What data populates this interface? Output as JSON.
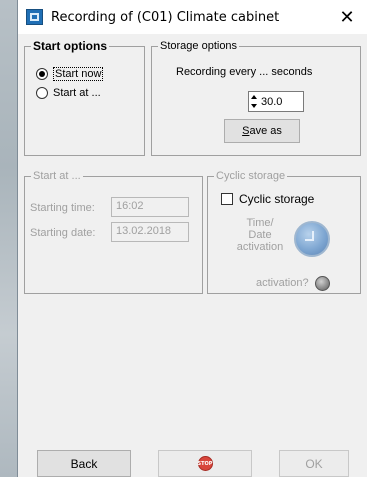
{
  "window": {
    "title": "Recording of (C01) Climate cabinet",
    "close_glyph": "✕"
  },
  "start_options": {
    "legend": "Start options",
    "start_now_label": "Start now",
    "start_at_label": "Start at ...",
    "selected": "start_now"
  },
  "storage_options": {
    "legend": "Storage options",
    "recording_label": "Recording every ... seconds",
    "interval_value": "30.0",
    "save_as_label": "Save as"
  },
  "start_at": {
    "legend": "Start at ...",
    "starting_time_label": "Starting time:",
    "starting_time_value": "16:02",
    "starting_date_label": "Starting date:",
    "starting_date_value": "13.02.2018"
  },
  "cyclic_storage": {
    "legend": "Cyclic storage",
    "checkbox_label": "Cyclic storage",
    "checked": false,
    "time_label_line1": "Time/",
    "time_label_line2": "Date",
    "time_label_line3": "activation",
    "activation_label": "activation?",
    "icon": "clock-icon"
  },
  "footer": {
    "back_label": "Back",
    "stop_icon_text": "STOP",
    "ok_label": "OK"
  },
  "colors": {
    "stop": "#d8453b",
    "disabled_text": "#a0a0a0",
    "clock": "#7fa7d2"
  }
}
